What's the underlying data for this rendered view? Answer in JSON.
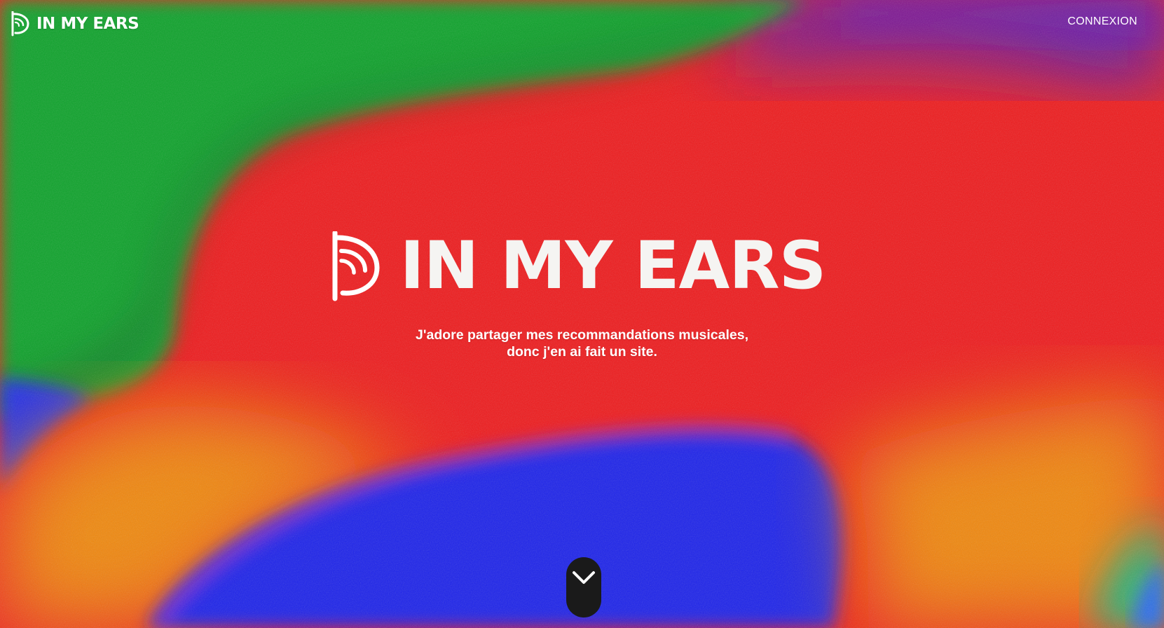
{
  "brand": {
    "name": "IN MY EARS",
    "logo_icon": "ear-signal-icon"
  },
  "nav": {
    "login_label": "CONNEXION"
  },
  "hero": {
    "title": "IN MY EARS",
    "tagline_line1": "J'adore partager mes recommandations musicales,",
    "tagline_line2": "donc j'en ai fait un site."
  },
  "scroll_button": {
    "icon": "chevron-down-icon"
  },
  "colors": {
    "green": "#0fa12a",
    "red": "#f01a1c",
    "blue": "#1d22e8",
    "orange": "#f08a12",
    "text": "#ffffff",
    "button": "#1a1a1a"
  }
}
